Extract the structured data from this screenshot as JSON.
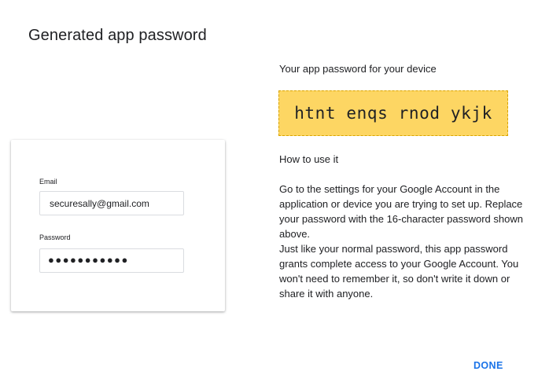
{
  "dialog": {
    "title": "Generated app password"
  },
  "illustration": {
    "email_label": "Email",
    "email_value": "securesally@gmail.com",
    "password_label": "Password",
    "password_dots": "●●●●●●●●●●●"
  },
  "result": {
    "subtitle": "Your app password for your device",
    "app_password": "htnt enqs rnod ykjk",
    "password_highlight_color": "#fdd663"
  },
  "instructions": {
    "title": "How to use it",
    "paragraph_1": "Go to the settings for your Google Account in the application or device you are trying to set up. Replace your password with the 16-character password shown above.",
    "paragraph_2": "Just like your normal password, this app password grants complete access to your Google Account. You won't need to remember it, so don't write it down or share it with anyone."
  },
  "actions": {
    "done_label": "DONE",
    "accent_color": "#1a73e8"
  }
}
